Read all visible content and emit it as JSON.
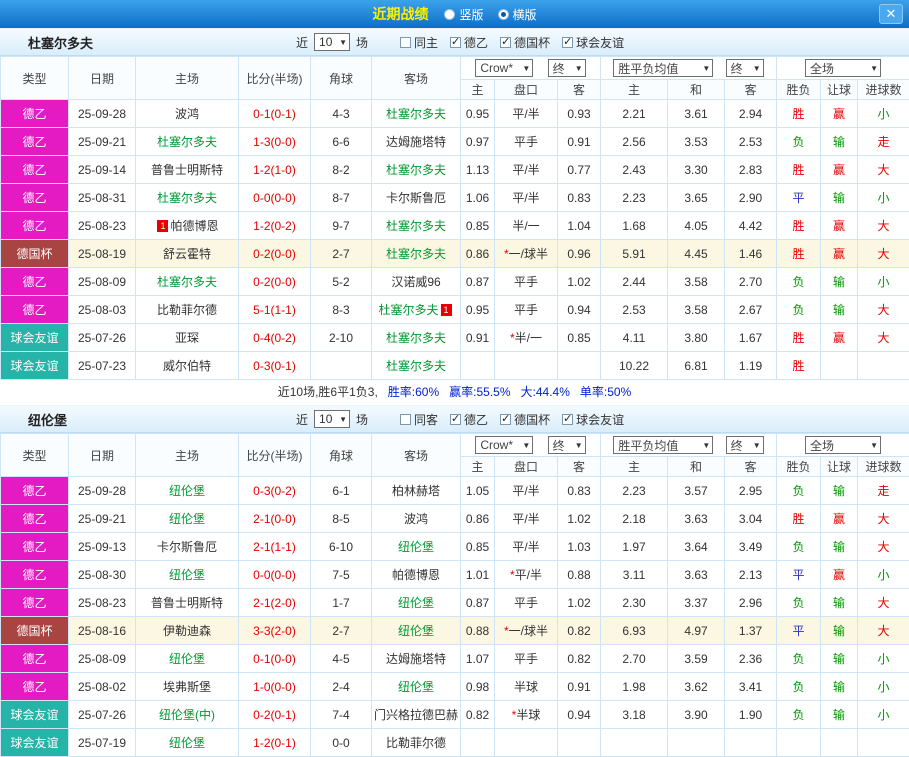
{
  "topbar": {
    "title": "近期战绩",
    "vertical_label": "竖版",
    "horizontal_label": "横版",
    "vertical_checked": false,
    "horizontal_checked": true
  },
  "icons": {
    "chevron_down": "▼",
    "close": "✕",
    "check": "✓"
  },
  "cup_type": "德国杯",
  "type_colors": {
    "德乙": "#e41bc3",
    "德国杯": "#a84441",
    "球会友谊": "#26b3a8"
  },
  "table_headers": [
    "类型",
    "日期",
    "主场",
    "比分(半场)",
    "角球",
    "客场"
  ],
  "table_subheaders": [
    "主",
    "盘口",
    "客",
    "主",
    "和",
    "客",
    "胜负",
    "让球",
    "进球数"
  ],
  "sections": [
    {
      "team": "杜塞尔多夫",
      "filters": {
        "near_label": "近",
        "near_value": "10",
        "near_suffix": "场",
        "same_label": "同主",
        "same_checked": false,
        "leagues": [
          {
            "label": "德乙",
            "checked": true
          },
          {
            "label": "德国杯",
            "checked": true
          },
          {
            "label": "球会友谊",
            "checked": true
          }
        ]
      },
      "dropdowns": {
        "company": "Crow*",
        "company_state": "终",
        "avg": "胜平负均值",
        "avg_state": "终",
        "scope": "全场"
      },
      "table": {
        "rows": [
          {
            "type": "德乙",
            "date": "25-09-28",
            "home": {
              "name": "波鸿",
              "green": false
            },
            "score": "0-1(0-1)",
            "corner": "4-3",
            "away": {
              "name": "杜塞尔多夫",
              "green": true
            },
            "odds": [
              "0.95",
              "平/半",
              "0.93"
            ],
            "avg": [
              "2.21",
              "3.61",
              "2.94"
            ],
            "result": {
              "text": "胜",
              "color": "red"
            },
            "handicap_result": {
              "text": "赢",
              "color": "red"
            },
            "goals": {
              "text": "小",
              "color": "green"
            }
          },
          {
            "type": "德乙",
            "date": "25-09-21",
            "home": {
              "name": "杜塞尔多夫",
              "green": true
            },
            "score": "1-3(0-0)",
            "corner": "6-6",
            "away": {
              "name": "达姆施塔特",
              "green": false
            },
            "odds": [
              "0.97",
              "平手",
              "0.91"
            ],
            "avg": [
              "2.56",
              "3.53",
              "2.53"
            ],
            "result": {
              "text": "负",
              "color": "green"
            },
            "handicap_result": {
              "text": "输",
              "color": "green"
            },
            "goals": {
              "text": "走",
              "color": "red"
            }
          },
          {
            "type": "德乙",
            "date": "25-09-14",
            "home": {
              "name": "普鲁士明斯特",
              "green": false
            },
            "score": "1-2(1-0)",
            "corner": "8-2",
            "away": {
              "name": "杜塞尔多夫",
              "green": true
            },
            "odds": [
              "1.13",
              "平/半",
              "0.77"
            ],
            "avg": [
              "2.43",
              "3.30",
              "2.83"
            ],
            "result": {
              "text": "胜",
              "color": "red"
            },
            "handicap_result": {
              "text": "赢",
              "color": "red"
            },
            "goals": {
              "text": "大",
              "color": "red"
            }
          },
          {
            "type": "德乙",
            "date": "25-08-31",
            "home": {
              "name": "杜塞尔多夫",
              "green": true
            },
            "score": "0-0(0-0)",
            "corner": "8-7",
            "away": {
              "name": "卡尔斯鲁厄",
              "green": false
            },
            "odds": [
              "1.06",
              "平/半",
              "0.83"
            ],
            "avg": [
              "2.23",
              "3.65",
              "2.90"
            ],
            "result": {
              "text": "平",
              "color": "blue"
            },
            "handicap_result": {
              "text": "输",
              "color": "green"
            },
            "goals": {
              "text": "小",
              "color": "green"
            }
          },
          {
            "type": "德乙",
            "date": "25-08-23",
            "home": {
              "name": "帕德博恩",
              "green": false,
              "badge_before": "1"
            },
            "score": "1-2(0-2)",
            "corner": "9-7",
            "away": {
              "name": "杜塞尔多夫",
              "green": true
            },
            "odds": [
              "0.85",
              "半/一",
              "1.04"
            ],
            "avg": [
              "1.68",
              "4.05",
              "4.42"
            ],
            "result": {
              "text": "胜",
              "color": "red"
            },
            "handicap_result": {
              "text": "赢",
              "color": "red"
            },
            "goals": {
              "text": "大",
              "color": "red"
            }
          },
          {
            "type": "德国杯",
            "date": "25-08-19",
            "home": {
              "name": "舒云霍特",
              "green": false
            },
            "score": "0-2(0-0)",
            "corner": "2-7",
            "away": {
              "name": "杜塞尔多夫",
              "green": true
            },
            "odds": [
              "0.86",
              "*一/球半",
              "0.96"
            ],
            "avg": [
              "5.91",
              "4.45",
              "1.46"
            ],
            "result": {
              "text": "胜",
              "color": "red"
            },
            "handicap_result": {
              "text": "赢",
              "color": "red"
            },
            "goals": {
              "text": "大",
              "color": "red"
            }
          },
          {
            "type": "德乙",
            "date": "25-08-09",
            "home": {
              "name": "杜塞尔多夫",
              "green": true
            },
            "score": "0-2(0-0)",
            "corner": "5-2",
            "away": {
              "name": "汉诺威96",
              "green": false
            },
            "odds": [
              "0.87",
              "平手",
              "1.02"
            ],
            "avg": [
              "2.44",
              "3.58",
              "2.70"
            ],
            "result": {
              "text": "负",
              "color": "green"
            },
            "handicap_result": {
              "text": "输",
              "color": "green"
            },
            "goals": {
              "text": "小",
              "color": "green"
            }
          },
          {
            "type": "德乙",
            "date": "25-08-03",
            "home": {
              "name": "比勒菲尔德",
              "green": false
            },
            "score": "5-1(1-1)",
            "corner": "8-3",
            "away": {
              "name": "杜塞尔多夫",
              "green": true,
              "badge_after": "1"
            },
            "odds": [
              "0.95",
              "平手",
              "0.94"
            ],
            "avg": [
              "2.53",
              "3.58",
              "2.67"
            ],
            "result": {
              "text": "负",
              "color": "green"
            },
            "handicap_result": {
              "text": "输",
              "color": "green"
            },
            "goals": {
              "text": "大",
              "color": "red"
            }
          },
          {
            "type": "球会友谊",
            "date": "25-07-26",
            "home": {
              "name": "亚琛",
              "green": false
            },
            "score": "0-4(0-2)",
            "corner": "2-10",
            "away": {
              "name": "杜塞尔多夫",
              "green": true
            },
            "odds": [
              "0.91",
              "*半/一",
              "0.85"
            ],
            "avg": [
              "4.11",
              "3.80",
              "1.67"
            ],
            "result": {
              "text": "胜",
              "color": "red"
            },
            "handicap_result": {
              "text": "赢",
              "color": "red"
            },
            "goals": {
              "text": "大",
              "color": "red"
            }
          },
          {
            "type": "球会友谊",
            "date": "25-07-23",
            "home": {
              "name": "威尔伯特",
              "green": false
            },
            "score": "0-3(0-1)",
            "corner": "",
            "away": {
              "name": "杜塞尔多夫",
              "green": true
            },
            "odds": [
              "",
              "",
              ""
            ],
            "avg": [
              "10.22",
              "6.81",
              "1.19"
            ],
            "result": {
              "text": "胜",
              "color": "red"
            },
            "handicap_result": {
              "text": "",
              "color": ""
            },
            "goals": {
              "text": "",
              "color": ""
            }
          }
        ]
      },
      "summary": {
        "games": "近10场,胜6平1负3,",
        "win_rate": "胜率:60%",
        "handicap_rate": "赢率:55.5%",
        "over_rate": "大:44.4%",
        "single_rate": "单率:50%"
      }
    },
    {
      "team": "纽伦堡",
      "filters": {
        "near_label": "近",
        "near_value": "10",
        "near_suffix": "场",
        "same_label": "同客",
        "same_checked": false,
        "leagues": [
          {
            "label": "德乙",
            "checked": true
          },
          {
            "label": "德国杯",
            "checked": true
          },
          {
            "label": "球会友谊",
            "checked": true
          }
        ]
      },
      "dropdowns": {
        "company": "Crow*",
        "company_state": "终",
        "avg": "胜平负均值",
        "avg_state": "终",
        "scope": "全场"
      },
      "table": {
        "rows": [
          {
            "type": "德乙",
            "date": "25-09-28",
            "home": {
              "name": "纽伦堡",
              "green": true
            },
            "score": "0-3(0-2)",
            "corner": "6-1",
            "away": {
              "name": "柏林赫塔",
              "green": false
            },
            "odds": [
              "1.05",
              "平/半",
              "0.83"
            ],
            "avg": [
              "2.23",
              "3.57",
              "2.95"
            ],
            "result": {
              "text": "负",
              "color": "green"
            },
            "handicap_result": {
              "text": "输",
              "color": "green"
            },
            "goals": {
              "text": "走",
              "color": "red"
            }
          },
          {
            "type": "德乙",
            "date": "25-09-21",
            "home": {
              "name": "纽伦堡",
              "green": true
            },
            "score": "2-1(0-0)",
            "corner": "8-5",
            "away": {
              "name": "波鸿",
              "green": false
            },
            "odds": [
              "0.86",
              "平/半",
              "1.02"
            ],
            "avg": [
              "2.18",
              "3.63",
              "3.04"
            ],
            "result": {
              "text": "胜",
              "color": "red"
            },
            "handicap_result": {
              "text": "赢",
              "color": "red"
            },
            "goals": {
              "text": "大",
              "color": "red"
            }
          },
          {
            "type": "德乙",
            "date": "25-09-13",
            "home": {
              "name": "卡尔斯鲁厄",
              "green": false
            },
            "score": "2-1(1-1)",
            "corner": "6-10",
            "away": {
              "name": "纽伦堡",
              "green": true
            },
            "odds": [
              "0.85",
              "平/半",
              "1.03"
            ],
            "avg": [
              "1.97",
              "3.64",
              "3.49"
            ],
            "result": {
              "text": "负",
              "color": "green"
            },
            "handicap_result": {
              "text": "输",
              "color": "green"
            },
            "goals": {
              "text": "大",
              "color": "red"
            }
          },
          {
            "type": "德乙",
            "date": "25-08-30",
            "home": {
              "name": "纽伦堡",
              "green": true
            },
            "score": "0-0(0-0)",
            "corner": "7-5",
            "away": {
              "name": "帕德博恩",
              "green": false
            },
            "odds": [
              "1.01",
              "*平/半",
              "0.88"
            ],
            "avg": [
              "3.11",
              "3.63",
              "2.13"
            ],
            "result": {
              "text": "平",
              "color": "blue"
            },
            "handicap_result": {
              "text": "赢",
              "color": "red"
            },
            "goals": {
              "text": "小",
              "color": "green"
            }
          },
          {
            "type": "德乙",
            "date": "25-08-23",
            "home": {
              "name": "普鲁士明斯特",
              "green": false
            },
            "score": "2-1(2-0)",
            "corner": "1-7",
            "away": {
              "name": "纽伦堡",
              "green": true
            },
            "odds": [
              "0.87",
              "平手",
              "1.02"
            ],
            "avg": [
              "2.30",
              "3.37",
              "2.96"
            ],
            "result": {
              "text": "负",
              "color": "green"
            },
            "handicap_result": {
              "text": "输",
              "color": "green"
            },
            "goals": {
              "text": "大",
              "color": "red"
            }
          },
          {
            "type": "德国杯",
            "date": "25-08-16",
            "home": {
              "name": "伊勒迪森",
              "green": false
            },
            "score": "3-3(2-0)",
            "corner": "2-7",
            "away": {
              "name": "纽伦堡",
              "green": true
            },
            "odds": [
              "0.88",
              "*一/球半",
              "0.82"
            ],
            "avg": [
              "6.93",
              "4.97",
              "1.37"
            ],
            "result": {
              "text": "平",
              "color": "blue"
            },
            "handicap_result": {
              "text": "输",
              "color": "green"
            },
            "goals": {
              "text": "大",
              "color": "red"
            }
          },
          {
            "type": "德乙",
            "date": "25-08-09",
            "home": {
              "name": "纽伦堡",
              "green": true
            },
            "score": "0-1(0-0)",
            "corner": "4-5",
            "away": {
              "name": "达姆施塔特",
              "green": false
            },
            "odds": [
              "1.07",
              "平手",
              "0.82"
            ],
            "avg": [
              "2.70",
              "3.59",
              "2.36"
            ],
            "result": {
              "text": "负",
              "color": "green"
            },
            "handicap_result": {
              "text": "输",
              "color": "green"
            },
            "goals": {
              "text": "小",
              "color": "green"
            }
          },
          {
            "type": "德乙",
            "date": "25-08-02",
            "home": {
              "name": "埃弗斯堡",
              "green": false
            },
            "score": "1-0(0-0)",
            "corner": "2-4",
            "away": {
              "name": "纽伦堡",
              "green": true
            },
            "odds": [
              "0.98",
              "半球",
              "0.91"
            ],
            "avg": [
              "1.98",
              "3.62",
              "3.41"
            ],
            "result": {
              "text": "负",
              "color": "green"
            },
            "handicap_result": {
              "text": "输",
              "color": "green"
            },
            "goals": {
              "text": "小",
              "color": "green"
            }
          },
          {
            "type": "球会友谊",
            "date": "25-07-26",
            "home": {
              "name": "纽伦堡(中)",
              "green": true
            },
            "score": "0-2(0-1)",
            "corner": "7-4",
            "away": {
              "name": "门兴格拉德巴赫",
              "green": false
            },
            "odds": [
              "0.82",
              "*半球",
              "0.94"
            ],
            "avg": [
              "3.18",
              "3.90",
              "1.90"
            ],
            "result": {
              "text": "负",
              "color": "green"
            },
            "handicap_result": {
              "text": "输",
              "color": "green"
            },
            "goals": {
              "text": "小",
              "color": "green"
            }
          },
          {
            "type": "球会友谊",
            "date": "25-07-19",
            "home": {
              "name": "纽伦堡",
              "green": true
            },
            "score": "1-2(0-1)",
            "corner": "0-0",
            "away": {
              "name": "比勒菲尔德",
              "green": false
            },
            "odds": [
              "",
              "",
              ""
            ],
            "avg": [
              "",
              "",
              ""
            ],
            "result": {
              "text": "",
              "color": ""
            },
            "handicap_result": {
              "text": "",
              "color": ""
            },
            "goals": {
              "text": "",
              "color": ""
            }
          }
        ]
      }
    }
  ]
}
